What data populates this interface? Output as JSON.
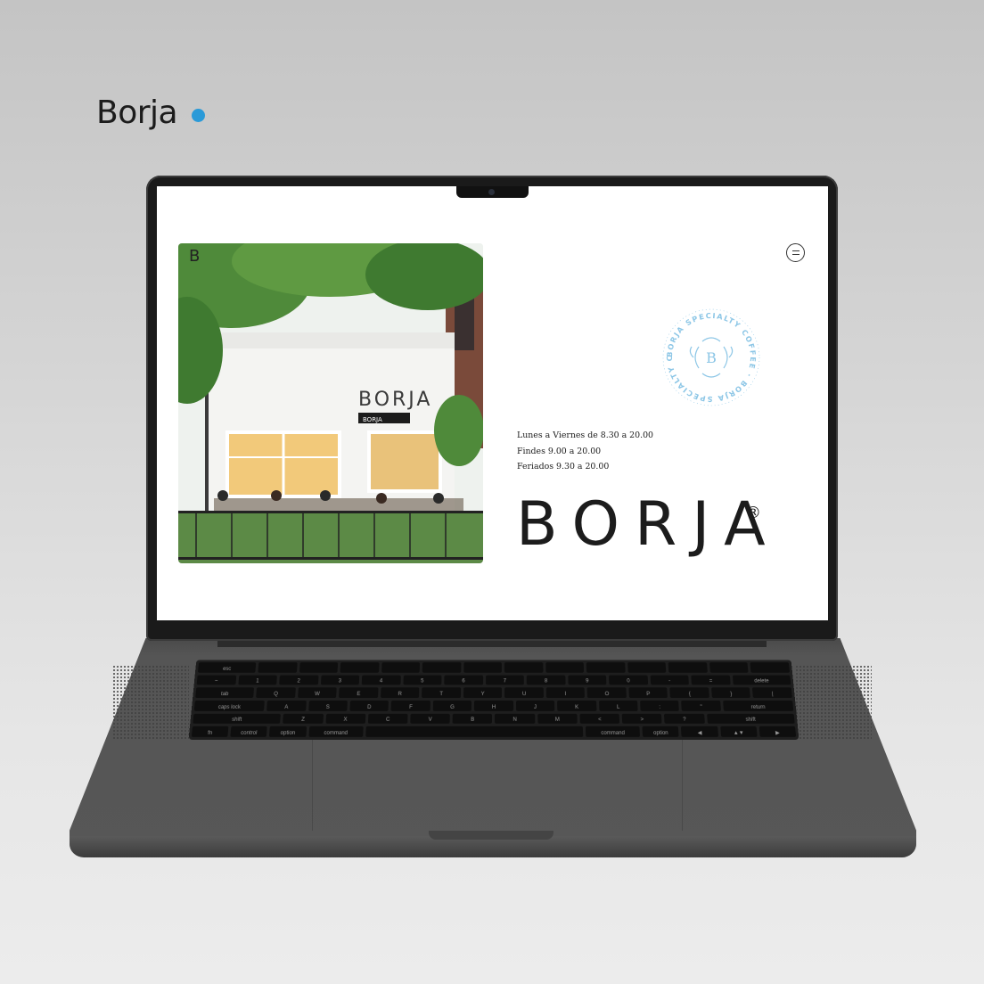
{
  "header": {
    "title": "Borja"
  },
  "colors": {
    "accent_dot": "#2a9ad8",
    "seal_blue": "#8cc6e6"
  },
  "website": {
    "menu_icon": "hamburger-icon",
    "photo": {
      "storefront_sign": "BORJA",
      "storefront_sign_small": "BORJA",
      "logo_corner": "B"
    },
    "seal": {
      "ring_text": "BORJA SPECIALTY COFFEE · BORJA SPECIALTY COFFEE ·",
      "center_letter": "B"
    },
    "hours": [
      "Lunes a Viernes de 8.30 a 20.00",
      "Findes 9.00 a 20.00",
      "Feriados 9.30 a 20.00"
    ],
    "wordmark": "BORJA",
    "registered": "®"
  },
  "keyboard": {
    "rows": [
      [
        "esc",
        "",
        "",
        "",
        "",
        "",
        "",
        "",
        "",
        "",
        "",
        "",
        "",
        ""
      ],
      [
        "~",
        "1",
        "2",
        "3",
        "4",
        "5",
        "6",
        "7",
        "8",
        "9",
        "0",
        "-",
        "=",
        "delete"
      ],
      [
        "tab",
        "Q",
        "W",
        "E",
        "R",
        "T",
        "Y",
        "U",
        "I",
        "O",
        "P",
        "{",
        "}",
        "|"
      ],
      [
        "caps lock",
        "A",
        "S",
        "D",
        "F",
        "G",
        "H",
        "J",
        "K",
        "L",
        ":",
        "\"",
        "return"
      ],
      [
        "shift",
        "Z",
        "X",
        "C",
        "V",
        "B",
        "N",
        "M",
        "<",
        ">",
        "?",
        "shift"
      ],
      [
        "fn",
        "control",
        "option",
        "command",
        "",
        "command",
        "option",
        "◀",
        "▲▼",
        "▶"
      ]
    ]
  }
}
